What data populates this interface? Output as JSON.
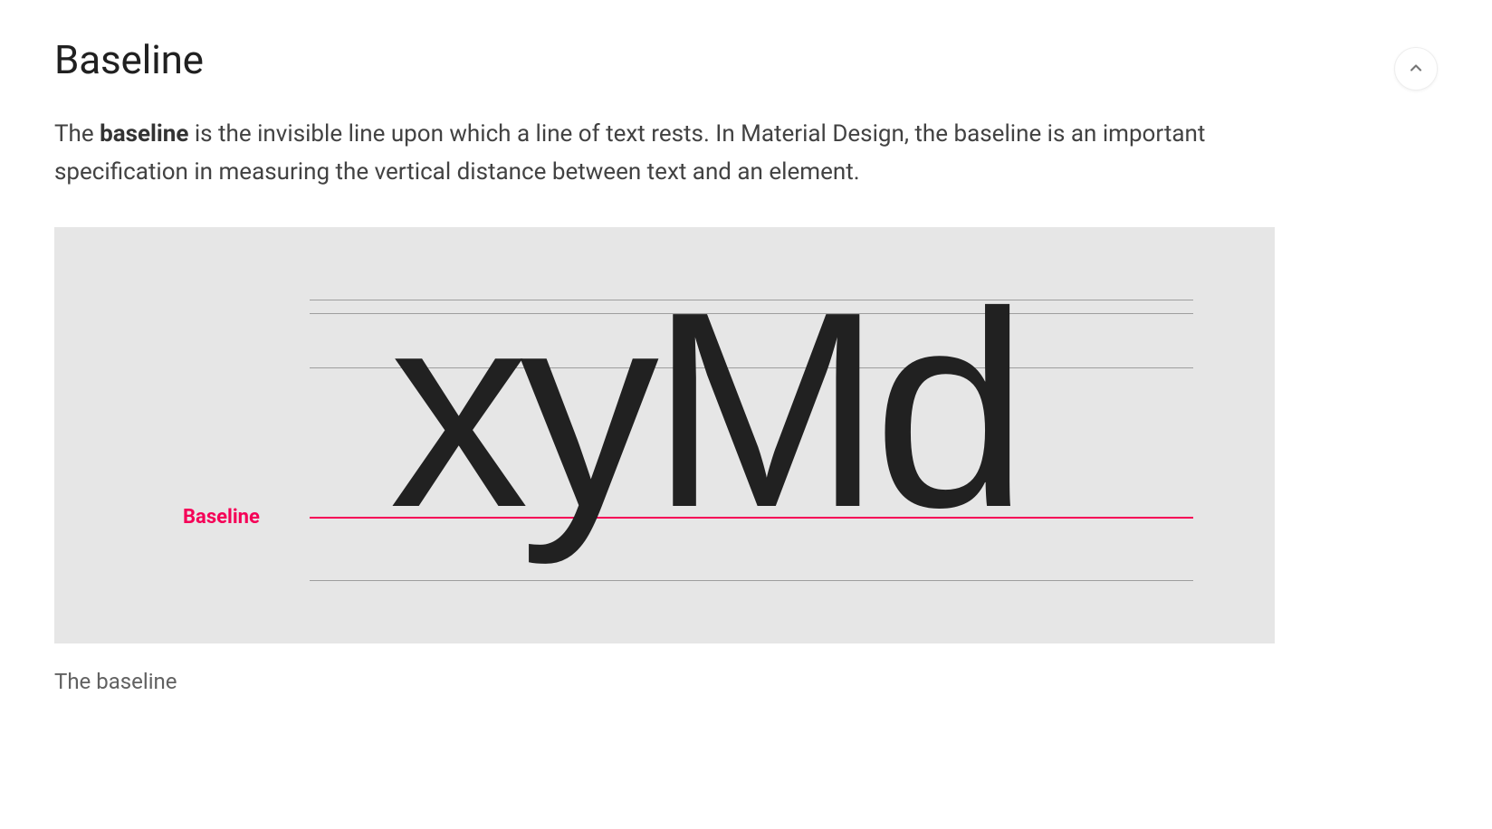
{
  "heading": "Baseline",
  "paragraph": {
    "prefix": "The ",
    "bold": "baseline",
    "rest": " is the invisible line upon which a line of text rests. In Material Design, the baseline is an important specification in measuring the vertical distance between text and an element."
  },
  "figure": {
    "sample_letters": "xyMd",
    "baseline_label": "Baseline",
    "guide_lines_y": [
      80,
      95,
      155,
      320,
      390
    ],
    "baseline_color": "#f50057",
    "guide_color": "#9e9e9e",
    "background": "#e6e6e6"
  },
  "caption": "The baseline",
  "icons": {
    "collapse": "chevron-up"
  }
}
